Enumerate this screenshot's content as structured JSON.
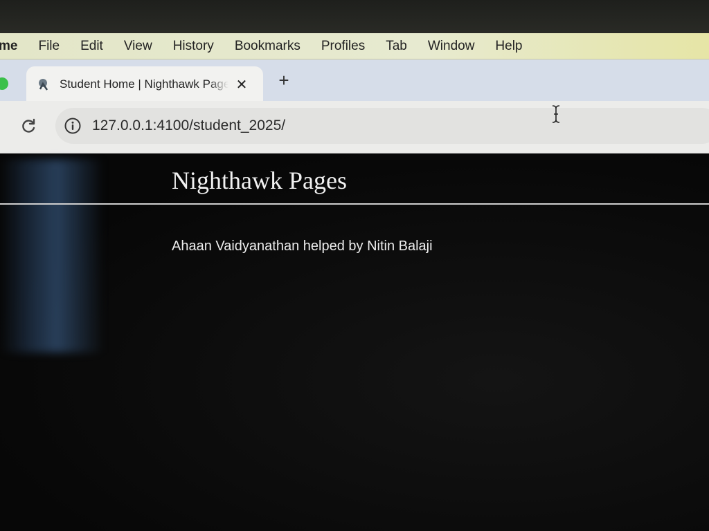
{
  "menubar": {
    "items": [
      "me",
      "File",
      "Edit",
      "View",
      "History",
      "Bookmarks",
      "Profiles",
      "Tab",
      "Window",
      "Help"
    ]
  },
  "tab": {
    "title": "Student Home | Nighthawk Pages",
    "favicon": "nighthawk-icon",
    "close_icon": "close-icon"
  },
  "new_tab": {
    "icon": "plus-icon",
    "label": "+"
  },
  "toolbar": {
    "reload_icon": "reload-icon",
    "site_info_icon": "info-icon",
    "url": "127.0.0.1:4100/student_2025/"
  },
  "page": {
    "site_title": "Nighthawk Pages",
    "credit": "Ahaan Vaidyanathan helped by Nitin Balaji"
  },
  "colors": {
    "menubar_bg": "#e5e8cc",
    "tabstrip_bg": "#d6dde9",
    "tab_bg": "#f2f2f0",
    "toolbar_bg": "#ececea",
    "page_bg": "#0b0b0b",
    "page_text": "#f1f1f1"
  }
}
